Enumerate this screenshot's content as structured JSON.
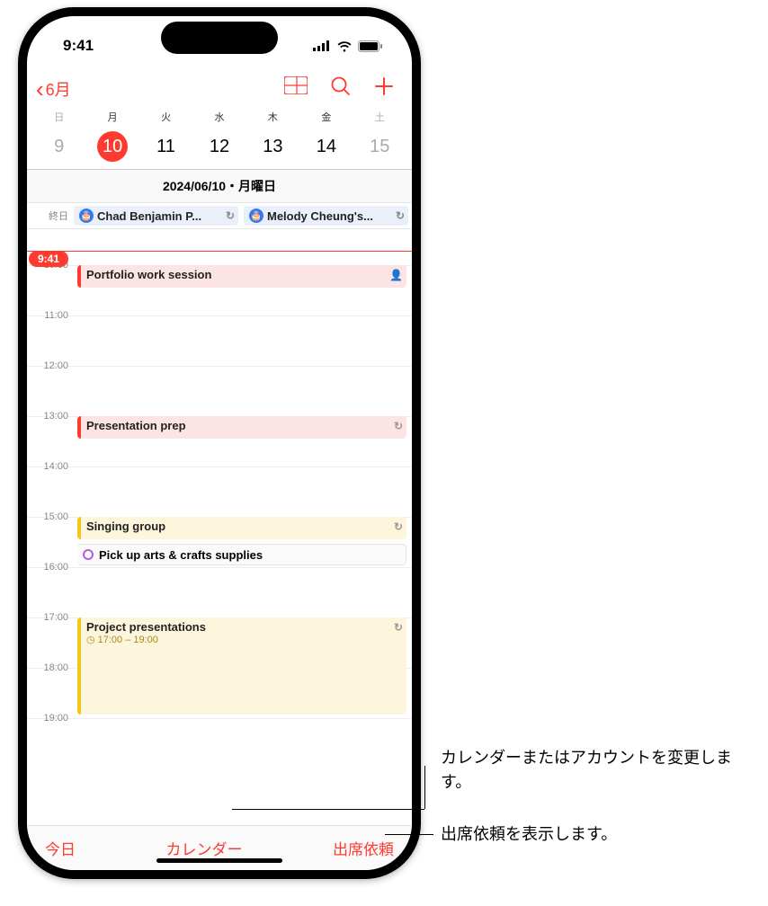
{
  "status": {
    "time": "9:41"
  },
  "nav": {
    "back": "6月"
  },
  "week": {
    "days": [
      {
        "dow": "日",
        "num": "9",
        "weekend": true
      },
      {
        "dow": "月",
        "num": "10",
        "selected": true
      },
      {
        "dow": "火",
        "num": "11"
      },
      {
        "dow": "水",
        "num": "12"
      },
      {
        "dow": "木",
        "num": "13"
      },
      {
        "dow": "金",
        "num": "14"
      },
      {
        "dow": "土",
        "num": "15",
        "weekend": true
      }
    ]
  },
  "dateLine": "2024/06/10・月曜日",
  "allday": {
    "label": "終日",
    "events": [
      {
        "text": "Chad Benjamin P..."
      },
      {
        "text": "Melody Cheung's..."
      }
    ]
  },
  "now": "9:41",
  "hours": [
    "10:00",
    "11:00",
    "12:00",
    "13:00",
    "14:00",
    "15:00",
    "16:00",
    "17:00",
    "18:00",
    "19:00"
  ],
  "events": {
    "portfolio": "Portfolio work session",
    "prep": "Presentation prep",
    "singing": "Singing group",
    "pickup": "Pick up arts & crafts supplies",
    "project": "Project presentations",
    "projectSub": "17:00 – 19:00"
  },
  "bottom": {
    "today": "今日",
    "calendars": "カレンダー",
    "inbox": "出席依頼"
  },
  "callouts": {
    "cal": "カレンダーまたはアカウントを変更します。",
    "inbox": "出席依頼を表示します。"
  }
}
